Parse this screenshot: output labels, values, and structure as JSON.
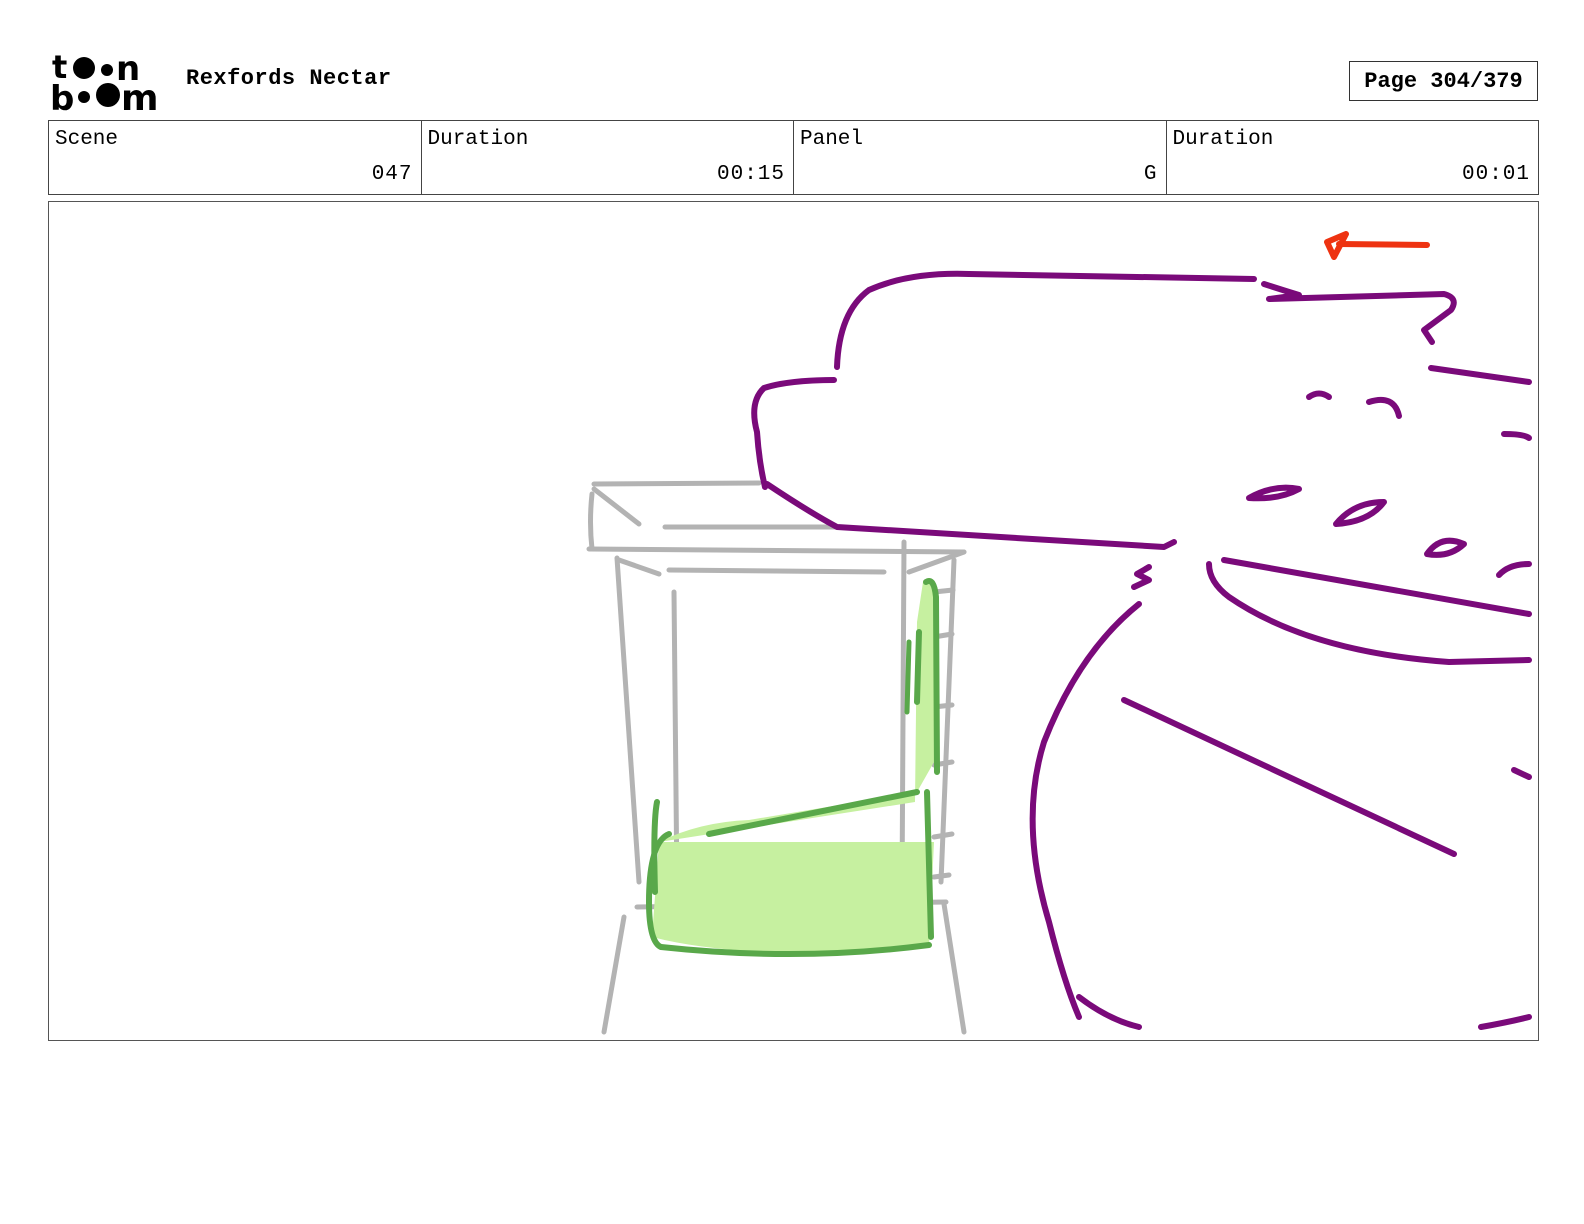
{
  "header": {
    "logo": {
      "icon": "toon-boom-logo",
      "text": "toon boom"
    },
    "project_title": "Rexfords Nectar",
    "page_indicator": "Page 304/379"
  },
  "info": [
    {
      "label": "Scene",
      "value": "047"
    },
    {
      "label": "Duration",
      "value": "00:15"
    },
    {
      "label": "Panel",
      "value": "G"
    },
    {
      "label": "Duration",
      "value": "00:01"
    }
  ],
  "panel": {
    "description_items": [
      "blender-sketch",
      "green-liquid",
      "purple-character-sketch",
      "red-direction-arrow"
    ],
    "colors": {
      "blender": "#b3b3b3",
      "liquid_fill": "#c6f0a0",
      "liquid_outline": "#59a84a",
      "character": "#7a0a7a",
      "arrow": "#ee3311"
    }
  }
}
